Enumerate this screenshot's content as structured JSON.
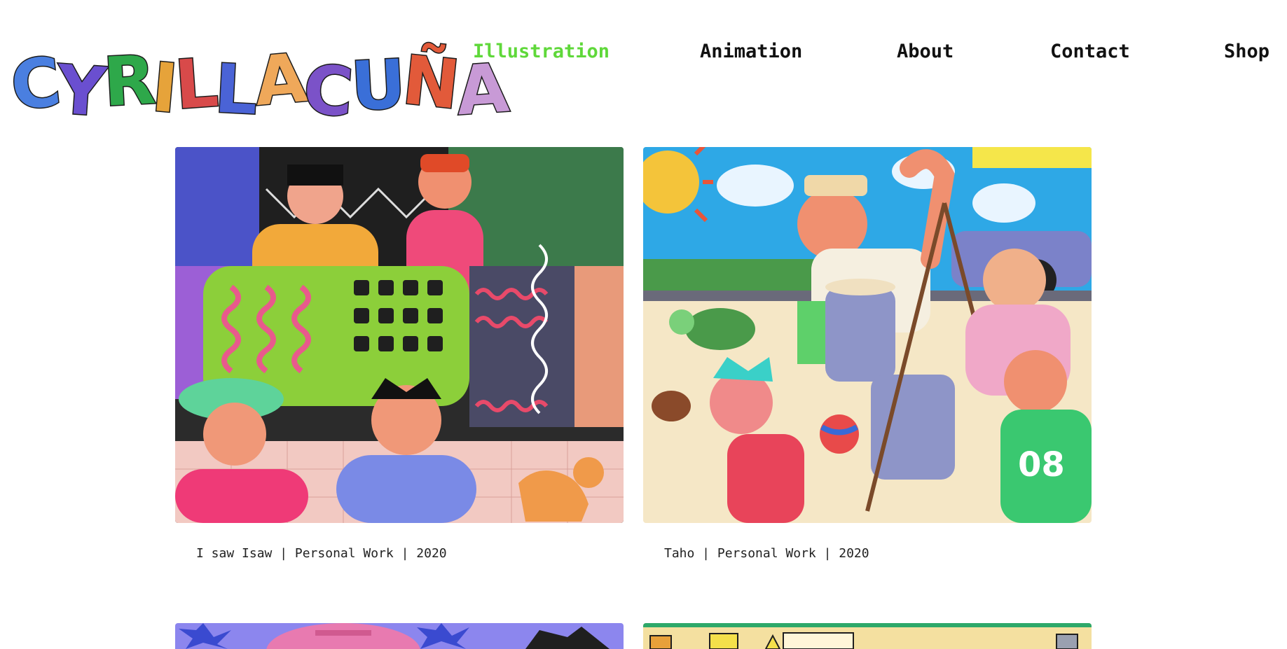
{
  "site": {
    "logo_text": "CYRILL ACUÑA",
    "logo_letters": [
      {
        "char": "C",
        "color": "#4a7fe0"
      },
      {
        "char": "Y",
        "color": "#6a4fd0"
      },
      {
        "char": "R",
        "color": "#2ea84a"
      },
      {
        "char": "I",
        "color": "#e6a33a"
      },
      {
        "char": "L",
        "color": "#d84a4a"
      },
      {
        "char": "L",
        "color": "#4a63d6"
      },
      {
        "char": " ",
        "color": "#ffffff"
      },
      {
        "char": "A",
        "color": "#efa85a"
      },
      {
        "char": "C",
        "color": "#7b52c8"
      },
      {
        "char": "U",
        "color": "#3a6fd8"
      },
      {
        "char": "Ñ",
        "color": "#e25a3a"
      },
      {
        "char": "A",
        "color": "#c89ad6"
      }
    ]
  },
  "nav": {
    "items": [
      {
        "label": "Illustration",
        "active": true
      },
      {
        "label": "Animation",
        "active": false
      },
      {
        "label": "About",
        "active": false
      },
      {
        "label": "Contact",
        "active": false
      },
      {
        "label": "Shop",
        "active": false
      }
    ],
    "active_color": "#5fd83a"
  },
  "gallery": {
    "items": [
      {
        "title": "I saw Isaw",
        "caption": "I saw Isaw | Personal Work | 2020"
      },
      {
        "title": "Taho",
        "caption": "Taho | Personal Work | 2020"
      }
    ]
  }
}
